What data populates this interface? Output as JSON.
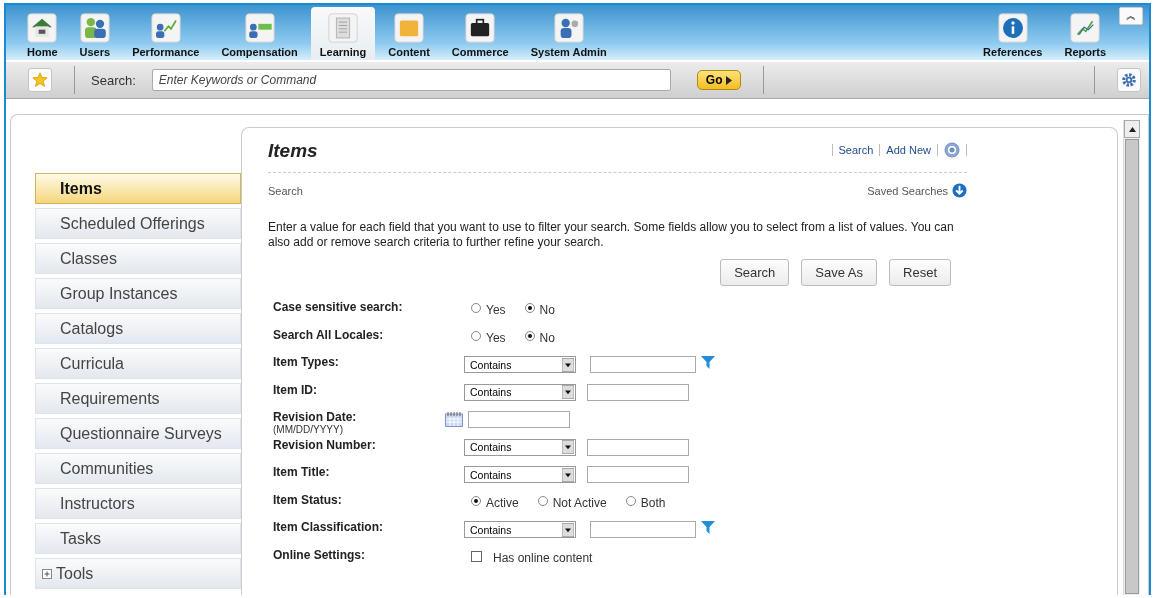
{
  "nav": {
    "left": [
      {
        "label": "Home",
        "selected": false
      },
      {
        "label": "Users",
        "selected": false
      },
      {
        "label": "Performance",
        "selected": false
      },
      {
        "label": "Compensation",
        "selected": false
      },
      {
        "label": "Learning",
        "selected": true
      },
      {
        "label": "Content",
        "selected": false
      },
      {
        "label": "Commerce",
        "selected": false
      },
      {
        "label": "System Admin",
        "selected": false
      }
    ],
    "right": [
      {
        "label": "References",
        "selected": false
      },
      {
        "label": "Reports",
        "selected": false
      }
    ],
    "collapse": "︽"
  },
  "toolbar": {
    "search_label": "Search:",
    "search_placeholder": "Enter Keywords or Command",
    "go": "Go"
  },
  "sidebar": {
    "items": [
      {
        "label": "Items",
        "selected": true
      },
      {
        "label": "Scheduled Offerings",
        "selected": false
      },
      {
        "label": "Classes",
        "selected": false
      },
      {
        "label": "Group Instances",
        "selected": false
      },
      {
        "label": "Catalogs",
        "selected": false
      },
      {
        "label": "Curricula",
        "selected": false
      },
      {
        "label": "Requirements",
        "selected": false
      },
      {
        "label": "Questionnaire Surveys",
        "selected": false
      },
      {
        "label": "Communities",
        "selected": false
      },
      {
        "label": "Instructors",
        "selected": false
      },
      {
        "label": "Tasks",
        "selected": false
      },
      {
        "label": "Tools",
        "selected": false,
        "expandable": true
      }
    ]
  },
  "content": {
    "title": "Items",
    "links": [
      "Search",
      "Add New"
    ],
    "section": "Search",
    "saved_searches": "Saved Searches",
    "intro": "Enter a value for each field that you want to use to filter your search. Some fields allow you to select from a list of values. You can also add or remove search criteria to further refine your search.",
    "buttons": [
      "Search",
      "Save As",
      "Reset"
    ],
    "fields": [
      {
        "kind": "radio",
        "label": "Case sensitive search:",
        "options": [
          {
            "label": "Yes",
            "selected": false
          },
          {
            "label": "No",
            "selected": true
          }
        ]
      },
      {
        "kind": "radio",
        "label": "Search All Locales:",
        "options": [
          {
            "label": "Yes",
            "selected": false
          },
          {
            "label": "No",
            "selected": true
          }
        ]
      },
      {
        "kind": "select",
        "label": "Item Types:",
        "operator": "Contains",
        "filter": true
      },
      {
        "kind": "select",
        "label": "Item ID:",
        "operator": "Contains",
        "filter": false
      },
      {
        "kind": "date",
        "label": "Revision Date:",
        "sublabel": "(MM/DD/YYYY)"
      },
      {
        "kind": "select",
        "label": "Revision Number:",
        "operator": "Contains",
        "filter": false
      },
      {
        "kind": "select",
        "label": "Item Title:",
        "operator": "Contains",
        "filter": false
      },
      {
        "kind": "radio",
        "label": "Item Status:",
        "options": [
          {
            "label": "Active",
            "selected": true
          },
          {
            "label": "Not Active",
            "selected": false
          },
          {
            "label": "Both",
            "selected": false
          }
        ]
      },
      {
        "kind": "select",
        "label": "Item Classification:",
        "operator": "Contains",
        "filter": true
      },
      {
        "kind": "checkbox",
        "label": "Online Settings:",
        "option": "Has online content",
        "checked": false
      }
    ]
  }
}
